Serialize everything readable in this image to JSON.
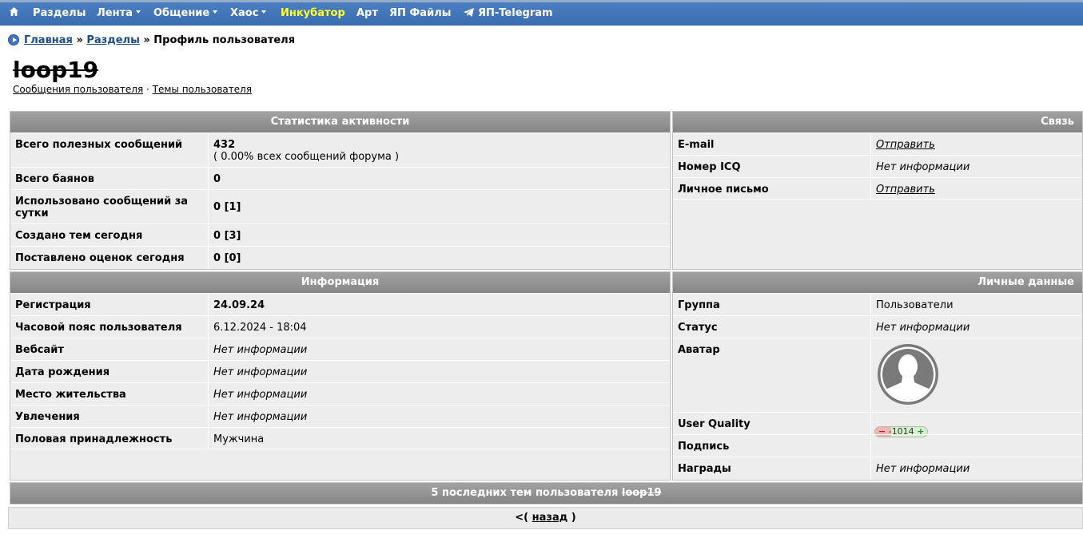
{
  "nav": {
    "home_icon": "home-icon",
    "items": [
      {
        "label": "Разделы"
      },
      {
        "label": "Лента"
      },
      {
        "label": "Общение"
      },
      {
        "label": "Хаос"
      },
      {
        "label": "Инкубатор"
      },
      {
        "label": "Арт"
      },
      {
        "label": "ЯП Файлы"
      },
      {
        "label": "ЯП-Telegram"
      }
    ]
  },
  "breadcrumb": {
    "home": "Главная",
    "sep": "»",
    "sections": "Разделы",
    "current": "Профиль пользователя"
  },
  "user": {
    "name": "loop19",
    "links": {
      "messages": "Сообщения пользователя",
      "sep": "·",
      "topics": "Темы пользователя"
    }
  },
  "stats": {
    "title": "Статистика активности",
    "rows": [
      {
        "label": "Всего полезных сообщений",
        "value": "432",
        "sub": "( 0.00% всех сообщений форума )"
      },
      {
        "label": "Всего баянов",
        "value": "0"
      },
      {
        "label": "Использовано сообщений за сутки",
        "value": "0 [1]"
      },
      {
        "label": "Создано тем сегодня",
        "value": "0 [3]"
      },
      {
        "label": "Поставлено оценок сегодня",
        "value": "0 [0]"
      }
    ]
  },
  "contact": {
    "title": "Связь",
    "rows": [
      {
        "label": "E-mail",
        "value": "Отправить"
      },
      {
        "label": "Номер ICQ",
        "value": "Нет информации"
      },
      {
        "label": "Личное письмо",
        "value": "Отправить"
      }
    ]
  },
  "info": {
    "title": "Информация",
    "rows": [
      {
        "label": "Регистрация",
        "value": "24.09.24"
      },
      {
        "label": "Часовой пояс пользователя",
        "value": "6.12.2024 - 18:04"
      },
      {
        "label": "Вебсайт",
        "value": "Нет информации"
      },
      {
        "label": "Дата рождения",
        "value": "Нет информации"
      },
      {
        "label": "Место жительства",
        "value": "Нет информации"
      },
      {
        "label": "Увлечения",
        "value": "Нет информации"
      },
      {
        "label": "Половая принадлежность",
        "value": "Мужчина"
      }
    ]
  },
  "personal": {
    "title": "Личные данные",
    "rows": [
      {
        "label": "Группа",
        "value": "Пользователи"
      },
      {
        "label": "Статус",
        "value": "Нет информации"
      },
      {
        "label": "Аватар",
        "value": ""
      },
      {
        "label": "User Quality",
        "minus": "−",
        "value": "-1014",
        "plus": "+"
      },
      {
        "label": "Подпись",
        "value": ""
      },
      {
        "label": "Награды",
        "value": "Нет информации"
      }
    ],
    "avatar_icon": "default-avatar-icon"
  },
  "last_topics": {
    "prefix": "5 последних тем пользователя",
    "user": "loop19"
  },
  "back": {
    "open": "<(",
    "label": "назад",
    "close": ")"
  },
  "colors": {
    "nav_bg": "#3a6cb0",
    "nav_highlight": "#ffff33",
    "link": "#1b4e8a",
    "panel_header": "#939393",
    "panel_bg": "#ededed"
  }
}
